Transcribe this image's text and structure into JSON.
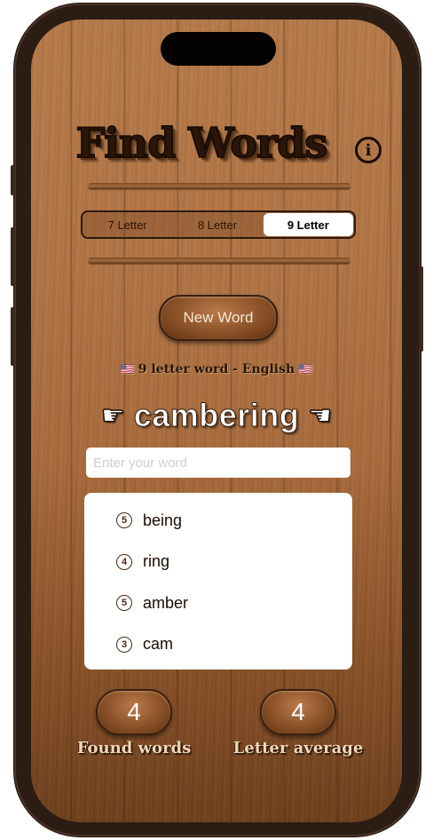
{
  "app": {
    "title": "Find Words",
    "info_icon": "info-icon"
  },
  "tabs": [
    {
      "label": "7 Letter",
      "selected": false
    },
    {
      "label": "8 Letter",
      "selected": false
    },
    {
      "label": "9 Letter",
      "selected": true
    }
  ],
  "new_word_label": "New Word",
  "subtitle": {
    "text": "9 letter word - English",
    "flag_icon": "us-flag-icon"
  },
  "current_word": "cambering",
  "pointer_left_icon": "hand-pointing-right-icon",
  "pointer_right_icon": "hand-pointing-left-icon",
  "input": {
    "value": "",
    "placeholder": "Enter your word"
  },
  "found_list": [
    {
      "count": "5",
      "word": "being"
    },
    {
      "count": "4",
      "word": "ring"
    },
    {
      "count": "5",
      "word": "amber"
    },
    {
      "count": "3",
      "word": "cam"
    }
  ],
  "stats": {
    "found_words": {
      "value": "4",
      "label": "Found words"
    },
    "letter_average": {
      "value": "4",
      "label": "Letter average"
    }
  },
  "colors": {
    "wood": "#b27545",
    "dark_ink": "#1a0c04",
    "selected_tab": "#ffffff"
  }
}
